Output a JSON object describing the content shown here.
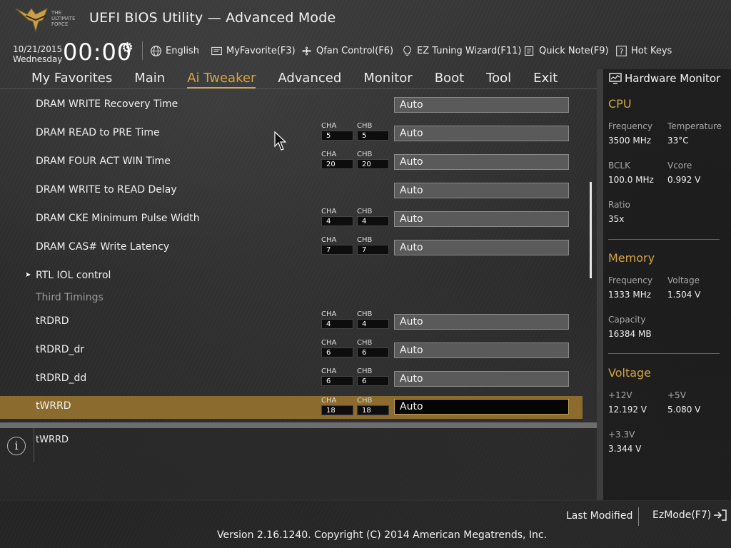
{
  "header": {
    "title": "UEFI BIOS Utility — Advanced Mode",
    "logo_text": "THE ULTIMATE FORCE",
    "date": "10/21/2015",
    "weekday": "Wednesday",
    "time": "00:00",
    "toolbar": {
      "language": "English",
      "my_favorite": "MyFavorite(F3)",
      "qfan": "Qfan Control(F6)",
      "ez_tuning": "EZ Tuning Wizard(F11)",
      "quick_note": "Quick Note(F9)",
      "hot_keys": "Hot Keys"
    }
  },
  "nav": {
    "tabs": [
      "My Favorites",
      "Main",
      "Ai Tweaker",
      "Advanced",
      "Monitor",
      "Boot",
      "Tool",
      "Exit"
    ],
    "active": "Ai Tweaker"
  },
  "settings": [
    {
      "label": "DRAM WRITE Recovery Time",
      "value": "Auto"
    },
    {
      "label": "DRAM READ to PRE Time",
      "cha": "5",
      "chb": "5",
      "value": "Auto"
    },
    {
      "label": "DRAM FOUR ACT WIN Time",
      "cha": "20",
      "chb": "20",
      "value": "Auto"
    },
    {
      "label": "DRAM WRITE to READ Delay",
      "value": "Auto"
    },
    {
      "label": "DRAM CKE Minimum Pulse Width",
      "cha": "4",
      "chb": "4",
      "value": "Auto"
    },
    {
      "label": "DRAM CAS# Write Latency",
      "cha": "7",
      "chb": "7",
      "value": "Auto"
    }
  ],
  "submenu": {
    "label": "RTL IOL control"
  },
  "section_header": "Third Timings",
  "third_settings": [
    {
      "label": "tRDRD",
      "cha": "4",
      "chb": "4",
      "value": "Auto"
    },
    {
      "label": "tRDRD_dr",
      "cha": "6",
      "chb": "6",
      "value": "Auto"
    },
    {
      "label": "tRDRD_dd",
      "cha": "6",
      "chb": "6",
      "value": "Auto"
    },
    {
      "label": "tWRRD",
      "cha": "18",
      "chb": "18",
      "value": "Auto"
    }
  ],
  "channel_labels": {
    "a": "CHA",
    "b": "CHB"
  },
  "info": {
    "text": "tWRRD",
    "icon": "i"
  },
  "hardware_monitor": {
    "title": "Hardware Monitor",
    "cpu": {
      "heading": "CPU",
      "frequency_label": "Frequency",
      "frequency": "3500 MHz",
      "temperature_label": "Temperature",
      "temperature": "33°C",
      "bclk_label": "BCLK",
      "bclk": "100.0 MHz",
      "vcore_label": "Vcore",
      "vcore": "0.992 V",
      "ratio_label": "Ratio",
      "ratio": "35x"
    },
    "memory": {
      "heading": "Memory",
      "frequency_label": "Frequency",
      "frequency": "1333 MHz",
      "voltage_label": "Voltage",
      "voltage": "1.504 V",
      "capacity_label": "Capacity",
      "capacity": "16384 MB"
    },
    "voltage": {
      "heading": "Voltage",
      "v12_label": "+12V",
      "v12": "12.192 V",
      "v5_label": "+5V",
      "v5": "5.080 V",
      "v33_label": "+3.3V",
      "v33": "3.344 V"
    }
  },
  "footer": {
    "last_modified": "Last Modified",
    "ezmode": "EzMode(F7)",
    "copyright": "Version 2.16.1240. Copyright (C) 2014 American Megatrends, Inc."
  },
  "colors": {
    "accent": "#d4a445",
    "selected_row": "#8c6c2e"
  }
}
